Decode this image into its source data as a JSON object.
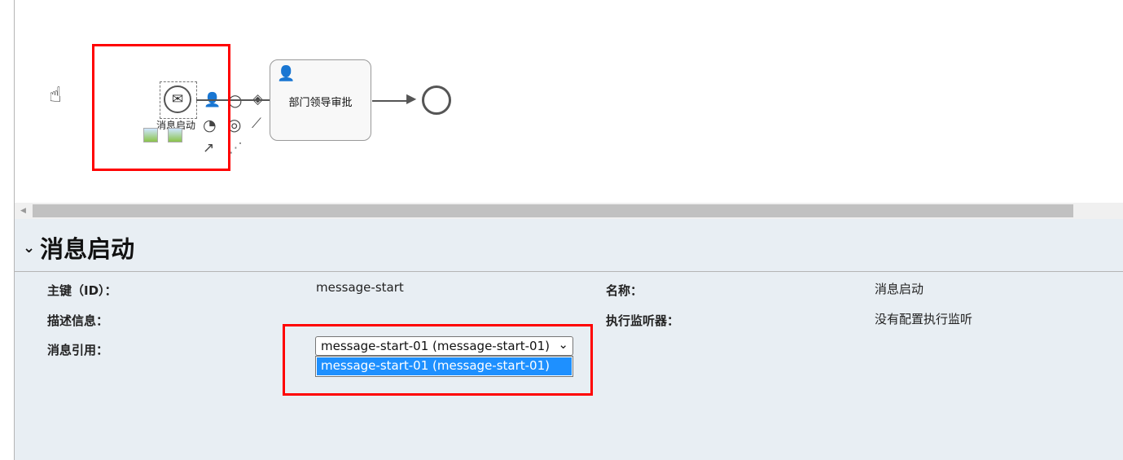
{
  "diagram": {
    "start_event_label": "消息启动",
    "task_label": "部门领导审批"
  },
  "properties": {
    "title": "消息启动",
    "fields": {
      "id_label": "主键（ID）：",
      "id_value": "message-start",
      "name_label": "名称：",
      "name_value": "消息启动",
      "desc_label": "描述信息：",
      "listener_label": "执行监听器：",
      "listener_value": "没有配置执行监听",
      "msgref_label": "消息引用：",
      "msgref_selected": "message-start-01 (message-start-01)",
      "msgref_option": "message-start-01 (message-start-01)"
    }
  },
  "colors": {
    "highlight": "#ff0000",
    "selected_option": "#1e90ff",
    "panel_bg": "#e8eef3",
    "user_icon": "#c8a25a"
  }
}
